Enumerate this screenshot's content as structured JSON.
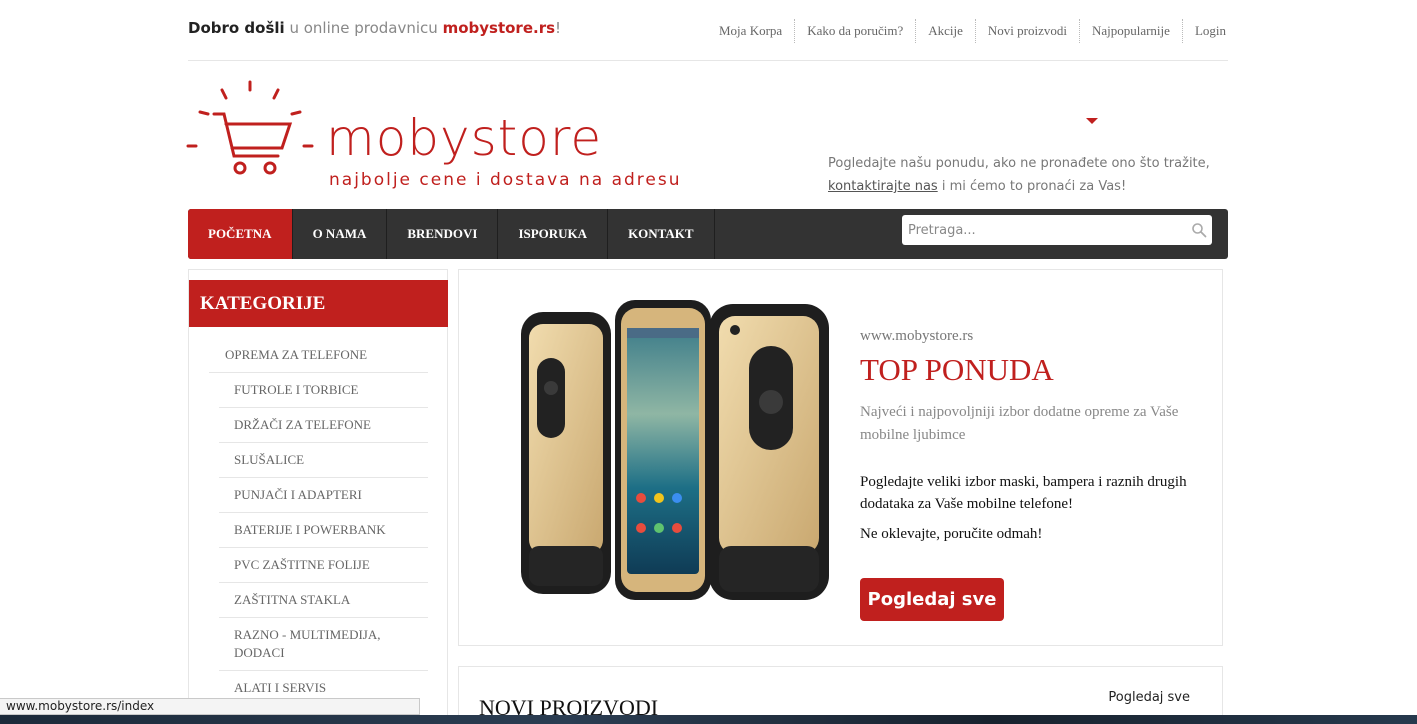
{
  "topbar": {
    "welcome_bold": "Dobro došli",
    "welcome_text": " u online prodavnicu ",
    "welcome_brand": "mobystore.rs",
    "welcome_end": "!",
    "links": [
      "Moja Korpa",
      "Kako da poručim?",
      "Akcije",
      "Novi proizvodi",
      "Najpopularnije",
      "Login"
    ]
  },
  "header": {
    "logo_word": "mobystore",
    "logo_tagline": "najbolje cene i dostava na adresu",
    "note_before": "Pogledajte našu ponudu, ako ne pronađete ono što tražite,",
    "note_link": "kontaktirajte nas",
    "note_after": " i mi ćemo to pronaći za Vas!"
  },
  "nav": {
    "items": [
      "POČETNA",
      "O NAMA",
      "BRENDOVI",
      "ISPORUKA",
      "KONTAKT"
    ],
    "active_index": 0,
    "search_placeholder": "Pretraga..."
  },
  "sidebar": {
    "title": "KATEGORIJE",
    "main_category": "OPREMA ZA TELEFONE",
    "items": [
      "FUTROLE I TORBICE",
      "DRŽAČI ZA TELEFONE",
      "SLUŠALICE",
      "PUNJAČI I ADAPTERI",
      "BATERIJE I POWERBANK",
      "PVC ZAŠTITNE FOLIJE",
      "ZAŠTITNA STAKLA",
      "RAZNO - MULTIMEDIJA, DODACI",
      "ALATI I SERVIS"
    ]
  },
  "hero": {
    "url": "www.mobystore.rs",
    "title": "TOP PONUDA",
    "subtitle": "Najveći i najpovoljniji izbor dodatne opreme za Vaše mobilne ljubimce",
    "text": "Pogledajte veliki izbor maski, bampera i raznih drugih dodataka za Vaše mobilne telefone!",
    "text2": "Ne oklevajte, poručite odmah!",
    "button": "Pogledaj sve"
  },
  "new_products": {
    "title": "NOVI PROIZVODI",
    "see_all": "Pogledaj sve"
  },
  "statusbar": {
    "url": "www.mobystore.rs/index"
  },
  "colors": {
    "accent": "#c0201e",
    "nav_bg": "#333333"
  }
}
